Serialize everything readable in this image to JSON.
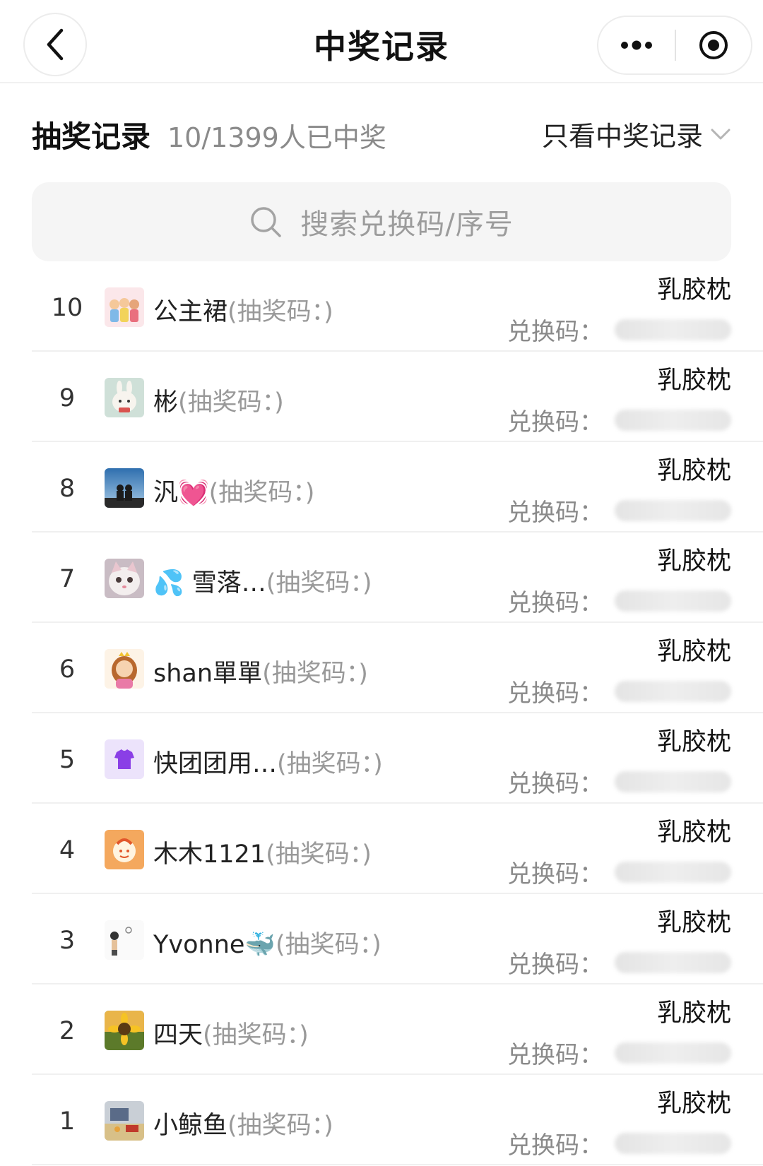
{
  "nav": {
    "title": "中奖记录"
  },
  "summary": {
    "label": "抽奖记录",
    "count": "10/1399人已中奖",
    "filter": "只看中奖记录"
  },
  "search": {
    "placeholder": "搜索兑换码/序号"
  },
  "records": [
    {
      "index": "10",
      "name": "公主裙",
      "code_label": "(抽奖码：)",
      "prize": "乳胶枕",
      "redeem_label": "兑换码："
    },
    {
      "index": "9",
      "name": "彬",
      "code_label": "(抽奖码：)",
      "prize": "乳胶枕",
      "redeem_label": "兑换码："
    },
    {
      "index": "8",
      "name": "汎💓",
      "code_label": "(抽奖码：)",
      "prize": "乳胶枕",
      "redeem_label": "兑换码："
    },
    {
      "index": "7",
      "name": "💦 雪落…",
      "code_label": "(抽奖码：)",
      "prize": "乳胶枕",
      "redeem_label": "兑换码："
    },
    {
      "index": "6",
      "name": "shan單單",
      "code_label": "(抽奖码：)",
      "prize": "乳胶枕",
      "redeem_label": "兑换码："
    },
    {
      "index": "5",
      "name": "快团团用…",
      "code_label": "(抽奖码：)",
      "prize": "乳胶枕",
      "redeem_label": "兑换码："
    },
    {
      "index": "4",
      "name": "木木1121",
      "code_label": "(抽奖码：)",
      "prize": "乳胶枕",
      "redeem_label": "兑换码："
    },
    {
      "index": "3",
      "name": "Yvonne🐳",
      "code_label": "(抽奖码：)",
      "prize": "乳胶枕",
      "redeem_label": "兑换码："
    },
    {
      "index": "2",
      "name": "四天",
      "code_label": "(抽奖码：)",
      "prize": "乳胶枕",
      "redeem_label": "兑换码："
    },
    {
      "index": "1",
      "name": "小鲸鱼",
      "code_label": "(抽奖码：)",
      "prize": "乳胶枕",
      "redeem_label": "兑换码："
    }
  ]
}
